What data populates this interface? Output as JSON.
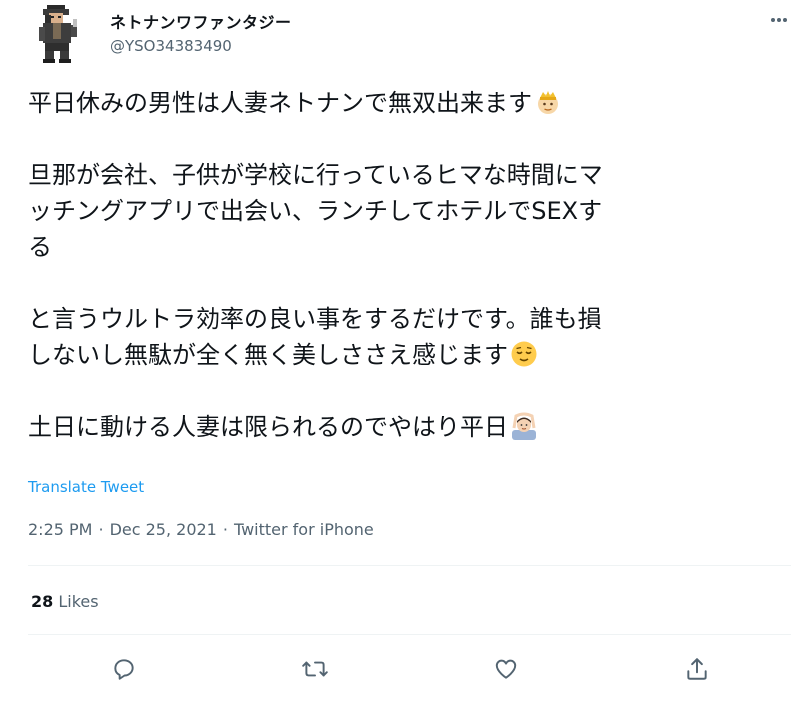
{
  "author": {
    "display_name": "ネトナンワファンタジー",
    "handle": "@YSO34383490"
  },
  "tweet": {
    "lines": [
      "平日休みの男性は人妻ネトナンで無双出来ます",
      "旦那が会社、子供が学校に行っているヒマな時間にマ",
      "ッチングアプリで出会い、ランチしてホテルでSEXす",
      "る",
      "と言うウルトラ効率の良い事をするだけです。誰も損",
      "しないし無駄が全く無く美しささえ感じます",
      "土日に動ける人妻は限られるのでやはり平日"
    ],
    "emojis": [
      "person-with-crown-emoji",
      "relieved-face-emoji",
      "person-gesturing-ok-emoji"
    ],
    "translate_label": "Translate Tweet"
  },
  "meta": {
    "time": "2:25 PM",
    "date": "Dec 25, 2021",
    "separator": "·",
    "source": "Twitter for iPhone"
  },
  "stats": {
    "likes_count": "28",
    "likes_label": "Likes"
  },
  "colors": {
    "text": "#0f1419",
    "secondary": "#536471",
    "link": "#1d9bf0",
    "divider": "#eff3f4"
  }
}
